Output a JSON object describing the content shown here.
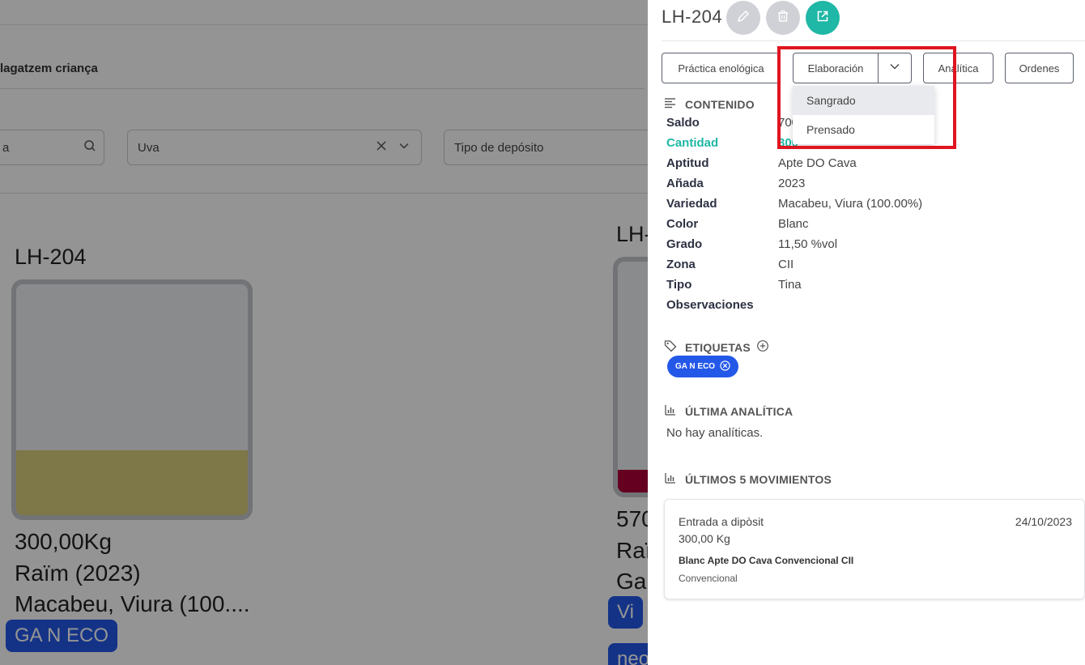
{
  "background": {
    "breadcrumb": "lagatzem criança",
    "filters": {
      "search_value": "a",
      "grape_value": "Uva",
      "tank_type_placeholder": "Tipo de depósito"
    },
    "tanks": [
      {
        "title": "LH-204",
        "fill_level": 0.28,
        "fill_color": "#d9cd7a",
        "weight": "300,00Kg",
        "product": "Raïm (2023)",
        "variety": "Macabeu, Viura (100....",
        "tags": [
          "GA N ECO"
        ]
      },
      {
        "title": "LH-",
        "fill_level": 0.1,
        "fill_color": "#b0003a",
        "weight": "570",
        "product": "Raï",
        "variety": "Ga",
        "tags": [
          "Vi",
          "neo"
        ]
      }
    ]
  },
  "panel": {
    "title": "LH-204",
    "colors": {
      "accent": "#1fb7a5",
      "tag_blue": "#2458e8",
      "highlight": "#e0141f",
      "edit_button_bg": "#cfd1d6",
      "delete_button_bg": "#cfd1d6",
      "open_button_bg": "#1fb7a5"
    },
    "tabs": {
      "practice": "Práctica enológica",
      "elaboration": "Elaboración",
      "analytics": "Analítica",
      "orders": "Ordenes"
    },
    "dropdown": {
      "options": [
        "Sangrado",
        "Prensado"
      ]
    },
    "content_heading": "CONTENIDO",
    "content": [
      {
        "key": "Saldo",
        "value": "700"
      },
      {
        "key": "Cantidad",
        "value": "300"
      },
      {
        "key": "Aptitud",
        "value": "Apte DO Cava"
      },
      {
        "key": "Añada",
        "value": "2023"
      },
      {
        "key": "Variedad",
        "value": "Macabeu, Viura (100.00%)"
      },
      {
        "key": "Color",
        "value": "Blanc"
      },
      {
        "key": "Grado",
        "value": "11,50 %vol"
      },
      {
        "key": "Zona",
        "value": "CII"
      },
      {
        "key": "Tipo",
        "value": "Tina"
      },
      {
        "key": "Observaciones",
        "value": ""
      }
    ],
    "tags_heading": "ETIQUETAS",
    "tags": [
      "GA N ECO"
    ],
    "last_analytics_heading": "ÚLTIMA ANALÍTICA",
    "last_analytics_empty": "No hay analíticas.",
    "movements_heading": "ÚLTIMOS 5 MOVIMIENTOS",
    "movements": [
      {
        "type": "Entrada a dipòsit",
        "date": "24/10/2023",
        "quantity": "300,00 Kg",
        "description": "Blanc Apte DO Cava Convencional CII",
        "category": "Convencional"
      }
    ]
  }
}
